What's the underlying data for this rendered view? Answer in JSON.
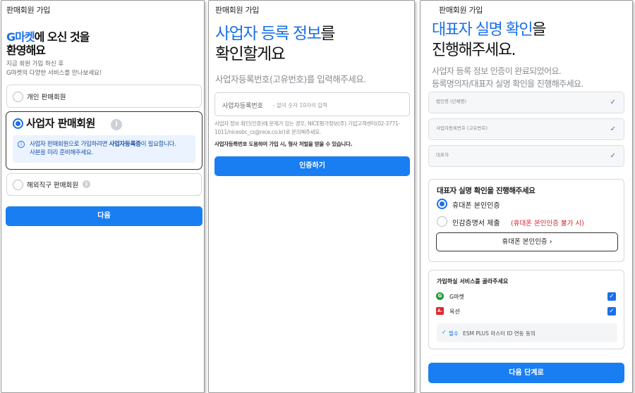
{
  "panel1": {
    "header": "판매회원 가입",
    "title_brand": "G마켓",
    "title_rest": "에 오신 것을",
    "title_line2": "환영해요",
    "intro1": "지금 회원 가입 하신 후",
    "intro2": "G마켓의 다양한 서비스를 만나보세요!",
    "opt_personal": "개인 판매회원",
    "opt_business": "사업자 판매회원",
    "notice_pre": "사업자 판매회원으로 가입하려면 ",
    "notice_strong": "사업자등록증",
    "notice_post": "이 필요합니다.",
    "notice_line2": "사본을 미리 준비해주세요.",
    "opt_overseas": "해외직구 판매회원",
    "next_button": "다음",
    "info_glyph": "i"
  },
  "panel2": {
    "header": "판매회원 가입",
    "title_blue": "사업자 등록 정보",
    "title_rest": "를",
    "title_line2": "확인할게요",
    "subtitle": "사업자등록번호(고유번호)를 입력해주세요.",
    "input_label": "사업자등록번호",
    "input_placeholder": "- 없이 숫자 10자리 입력",
    "note_line1": "사업자 정보 확인(인증)에 문제가 있는 경우, NICE평가정보(주) 기업고객센터(02-3771-",
    "note_line2": "1011/nicesbc_cs@nice.co.kr)로 문의해주세요.",
    "warning": "사업자등록번호 도용하여 가입 시, 형사 처벌을 받을 수 있습니다.",
    "verify_button": "인증하기"
  },
  "panel3": {
    "header": "판매회원 가입",
    "title_blue": "대표자 실명 확인",
    "title_rest": "을",
    "title_line2": "진행해주세요.",
    "subtitle1": "사업자 등록 정보 인증이 완료되었어요.",
    "subtitle2": "등록명의자/대표자 실명 확인을 진행해주세요.",
    "fields": [
      {
        "label": "법인명 (단체명)"
      },
      {
        "label": "사업자등록번호 (고유번호)"
      },
      {
        "label": "대표자"
      }
    ],
    "verify_title": "대표자 실명 확인을 진행해주세요",
    "opt_phone": "휴대폰 본인인증",
    "opt_cert": "인감증명서 제출",
    "cert_note": "(휴대폰 본인인증 불가 시)",
    "phone_button": "휴대폰 본인인증",
    "services_title": "가입하실 서비스를 골라주세요",
    "service_gmarket": "G마켓",
    "service_auction": "옥션",
    "gmarket_logo": "G",
    "auction_logo": "A.",
    "esm_required": "필수",
    "esm_text": "ESM PLUS 마스터 ID 연동 동의",
    "next_button": "다음 단계로"
  },
  "icons": {
    "check": "✓",
    "chevron": "›"
  },
  "colors": {
    "accent": "#1a6fe8",
    "button": "#1a7ef3",
    "error_red": "#d6232b",
    "gmarket_green": "#1f9d3a",
    "auction_red": "#e0262e"
  }
}
